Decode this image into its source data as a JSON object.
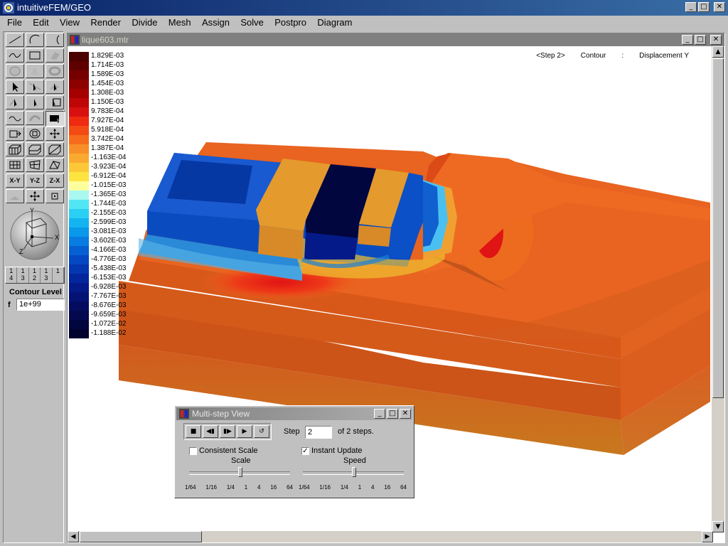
{
  "app": {
    "title": "intuitiveFEM/GEO"
  },
  "menu": [
    "File",
    "Edit",
    "View",
    "Render",
    "Divide",
    "Mesh",
    "Assign",
    "Solve",
    "Postpro",
    "Diagram"
  ],
  "child": {
    "title": "lique603.mtr",
    "header": {
      "step": "<Step 2>",
      "mode": "Contour",
      "sep": ":",
      "quantity": "Displacement Y"
    }
  },
  "legend": [
    {
      "label": "1.829E-03",
      "color": "#4a0000"
    },
    {
      "label": "1.714E-03",
      "color": "#5e0000"
    },
    {
      "label": "1.589E-03",
      "color": "#760000"
    },
    {
      "label": "1.454E-03",
      "color": "#8c0000"
    },
    {
      "label": "1.308E-03",
      "color": "#a40000"
    },
    {
      "label": "1.150E-03",
      "color": "#be0606"
    },
    {
      "label": "9.783E-04",
      "color": "#d81010"
    },
    {
      "label": "7.927E-04",
      "color": "#ee2a10"
    },
    {
      "label": "5.918E-04",
      "color": "#f44a14"
    },
    {
      "label": "3.742E-04",
      "color": "#f66c1c"
    },
    {
      "label": "1.387E-04",
      "color": "#f88e28"
    },
    {
      "label": "-1.163E-04",
      "color": "#faaa30"
    },
    {
      "label": "-3.923E-04",
      "color": "#fcc838"
    },
    {
      "label": "-6.912E-04",
      "color": "#fee440"
    },
    {
      "label": "-1.015E-03",
      "color": "#fefe9c"
    },
    {
      "label": "-1.365E-03",
      "color": "#a8f8f0"
    },
    {
      "label": "-1.744E-03",
      "color": "#52e6f4"
    },
    {
      "label": "-2.155E-03",
      "color": "#2ad0f4"
    },
    {
      "label": "-2.599E-03",
      "color": "#14b4f0"
    },
    {
      "label": "-3.081E-03",
      "color": "#0a98ea"
    },
    {
      "label": "-3.602E-03",
      "color": "#087ce0"
    },
    {
      "label": "-4.166E-03",
      "color": "#0660d2"
    },
    {
      "label": "-4.776E-03",
      "color": "#0448c2"
    },
    {
      "label": "-5.438E-03",
      "color": "#0436b0"
    },
    {
      "label": "-6.153E-03",
      "color": "#04269c"
    },
    {
      "label": "-6.928E-03",
      "color": "#041a88"
    },
    {
      "label": "-7.767E-03",
      "color": "#041274"
    },
    {
      "label": "-8.676E-03",
      "color": "#040c60"
    },
    {
      "label": "-9.659E-03",
      "color": "#04084e"
    },
    {
      "label": "-1.072E-02",
      "color": "#02063e"
    },
    {
      "label": "-1.188E-02",
      "color": "#020430"
    }
  ],
  "toolbox": {
    "step_tabs": [
      "1\n4",
      "1\n3",
      "1\n2",
      "1\n3",
      "1"
    ],
    "contour_level_label": "Contour Level",
    "f_prefix": "f",
    "contour_level_value": "1e+99",
    "cube_axes": {
      "y": "Y",
      "x": "X",
      "z": "Z"
    },
    "axis_buttons": [
      "X-Y",
      "Y-Z",
      "Z-X"
    ]
  },
  "multistep": {
    "title": "Multi-step View",
    "step_label": "Step",
    "step_value": "2",
    "of_steps": "of 2 steps.",
    "consistent_scale": {
      "label": "Consistent Scale",
      "checked": false
    },
    "instant_update": {
      "label": "Instant Update",
      "checked": true
    },
    "scale_label": "Scale",
    "speed_label": "Speed",
    "ticks": [
      "1/64",
      "1/16",
      "1/4",
      "1",
      "4",
      "16",
      "64"
    ],
    "check_mark": "✓"
  }
}
